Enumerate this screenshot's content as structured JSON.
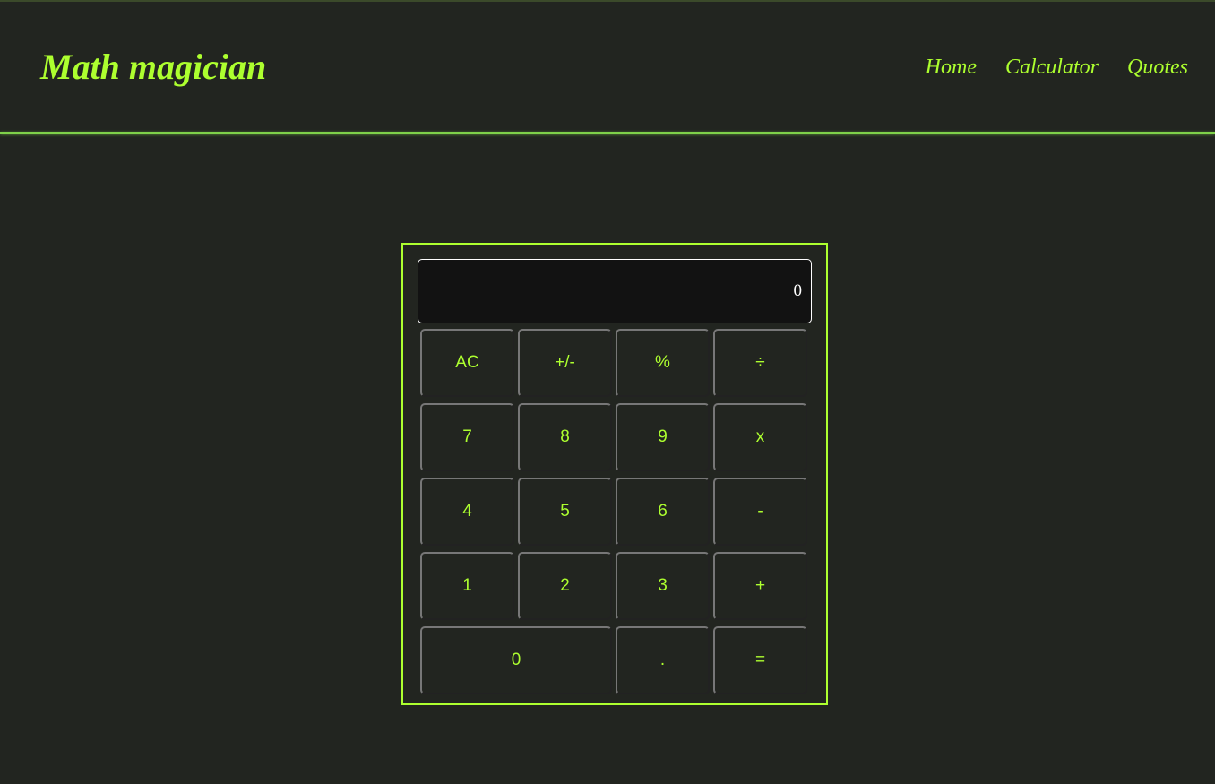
{
  "header": {
    "title": "Math magician",
    "nav": [
      {
        "label": "Home"
      },
      {
        "label": "Calculator"
      },
      {
        "label": "Quotes"
      }
    ]
  },
  "calculator": {
    "display_value": "0",
    "keys": [
      {
        "label": "AC",
        "name": "key-ac"
      },
      {
        "label": "+/-",
        "name": "key-plus-minus"
      },
      {
        "label": "%",
        "name": "key-percent"
      },
      {
        "label": "÷",
        "name": "key-divide"
      },
      {
        "label": "7",
        "name": "key-7"
      },
      {
        "label": "8",
        "name": "key-8"
      },
      {
        "label": "9",
        "name": "key-9"
      },
      {
        "label": "x",
        "name": "key-multiply"
      },
      {
        "label": "4",
        "name": "key-4"
      },
      {
        "label": "5",
        "name": "key-5"
      },
      {
        "label": "6",
        "name": "key-6"
      },
      {
        "label": "-",
        "name": "key-minus"
      },
      {
        "label": "1",
        "name": "key-1"
      },
      {
        "label": "2",
        "name": "key-2"
      },
      {
        "label": "3",
        "name": "key-3"
      },
      {
        "label": "+",
        "name": "key-plus"
      },
      {
        "label": "0",
        "name": "key-0",
        "wide": true
      },
      {
        "label": ".",
        "name": "key-decimal"
      },
      {
        "label": "=",
        "name": "key-equals"
      }
    ]
  },
  "colors": {
    "accent": "#adff2f",
    "background": "#222520",
    "display_background": "#121212"
  }
}
